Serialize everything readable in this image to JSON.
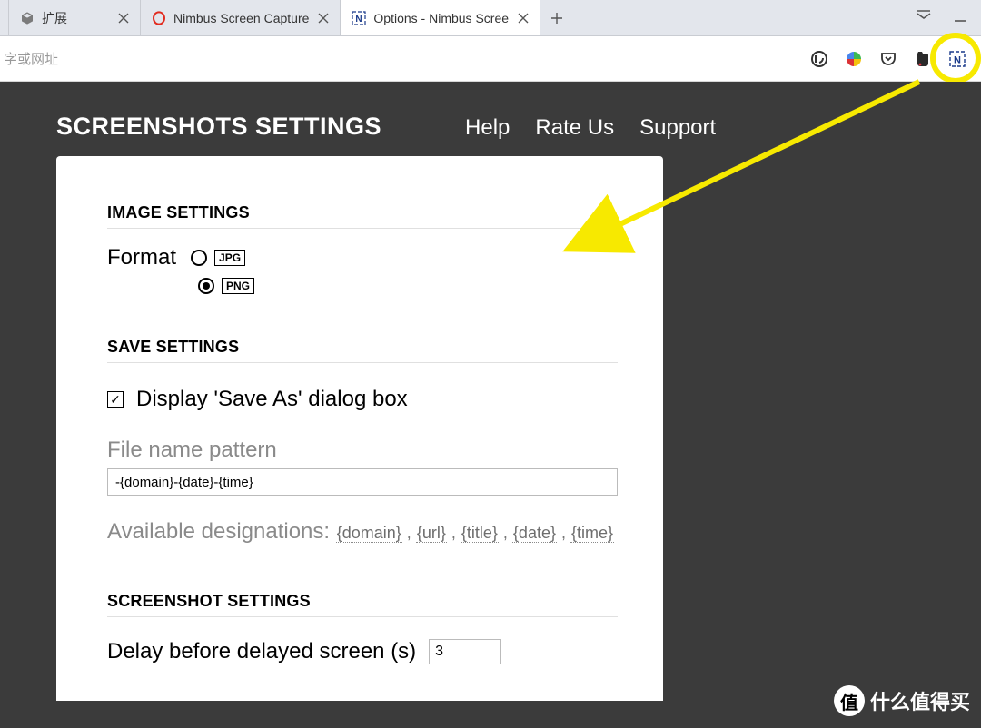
{
  "tabs": {
    "0": {
      "title": "扩展"
    },
    "1": {
      "title": "Nimbus Screen Capture"
    },
    "2": {
      "title": "Options - Nimbus Scree"
    }
  },
  "addressbar": {
    "placeholder": "字或网址"
  },
  "header": {
    "title": "SCREENSHOTS SETTINGS",
    "nav": {
      "help": "Help",
      "rate": "Rate Us",
      "support": "Support"
    }
  },
  "image_settings": {
    "title": "IMAGE SETTINGS",
    "format_label": "Format",
    "options": {
      "jpg": "JPG",
      "png": "PNG"
    }
  },
  "save_settings": {
    "title": "SAVE SETTINGS",
    "display_save_as": "Display 'Save As' dialog box",
    "file_name_pattern_label": "File name pattern",
    "file_name_pattern_value": "-{domain}-{date}-{time}",
    "available_label": "Available designations:",
    "tokens": {
      "domain": "{domain}",
      "url": "{url}",
      "title": "{title}",
      "date": "{date}",
      "time": "{time}"
    }
  },
  "screenshot_settings": {
    "title": "SCREENSHOT SETTINGS",
    "delay_label": "Delay before delayed screen (s)",
    "delay_value": "3"
  },
  "watermark": {
    "badge": "值",
    "text": "什么值得买"
  }
}
